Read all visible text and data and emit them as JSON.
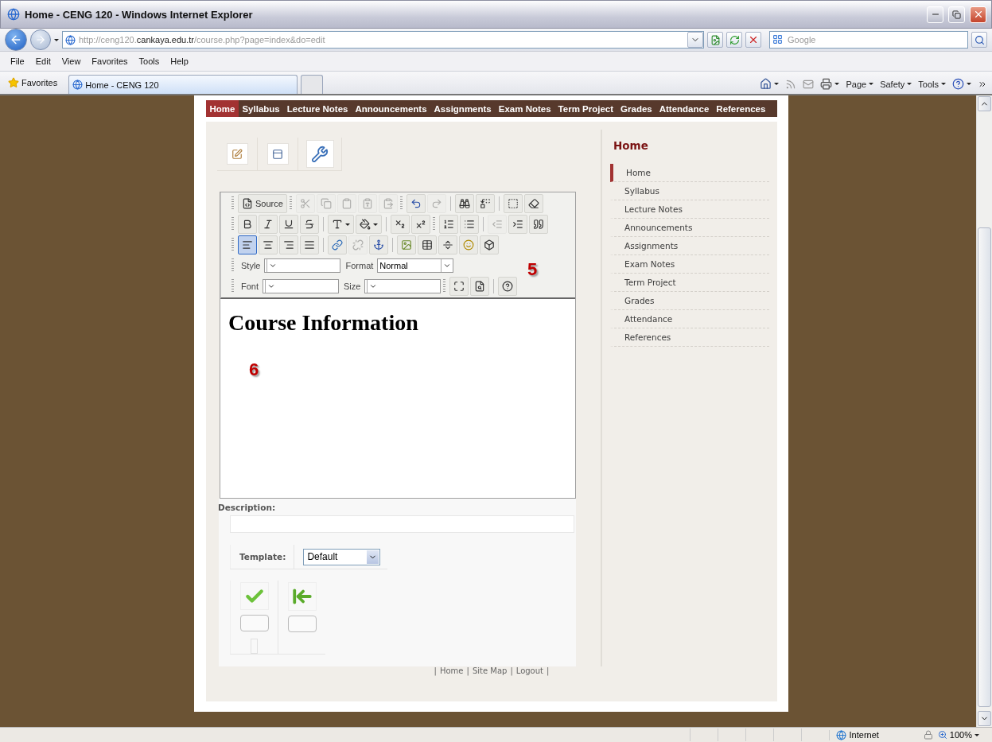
{
  "window": {
    "title": "Home - CENG 120 - Windows Internet Explorer"
  },
  "address_bar": {
    "url_prefix": "http://ceng120.",
    "url_host": "cankaya.edu.tr",
    "url_path": "/course.php?page=index&do=edit"
  },
  "search": {
    "placeholder": "Google"
  },
  "menu": [
    "File",
    "Edit",
    "View",
    "Favorites",
    "Tools",
    "Help"
  ],
  "favorites_bar": {
    "label": "Favorites",
    "tabs": [
      {
        "label": "Home - CENG 120",
        "selected": true
      }
    ]
  },
  "command_bar": [
    {
      "label": "Page"
    },
    {
      "label": "Safety"
    },
    {
      "label": "Tools"
    }
  ],
  "site_nav": [
    {
      "label": "Home",
      "selected": true
    },
    {
      "label": "Syllabus",
      "selected": false
    },
    {
      "label": "Lecture Notes",
      "selected": false
    },
    {
      "label": "Announcements",
      "selected": false
    },
    {
      "label": "Assignments",
      "selected": false
    },
    {
      "label": "Exam Notes",
      "selected": false
    },
    {
      "label": "Term Project",
      "selected": false
    },
    {
      "label": "Grades",
      "selected": false
    },
    {
      "label": "Attendance",
      "selected": false
    },
    {
      "label": "References",
      "selected": false
    }
  ],
  "editor": {
    "heading": "Course Information",
    "toolbar_rows": [
      [
        {
          "kind": "grip"
        },
        {
          "kind": "button",
          "label": "Source",
          "disabled": false,
          "selected": false
        },
        {
          "kind": "grip"
        },
        {
          "kind": "button",
          "disabled": true,
          "selected": false
        },
        {
          "kind": "button",
          "disabled": true,
          "selected": false
        },
        {
          "kind": "button",
          "disabled": true,
          "selected": false
        },
        {
          "kind": "button",
          "disabled": true,
          "selected": false
        },
        {
          "kind": "button",
          "disabled": true,
          "selected": false
        },
        {
          "kind": "grip"
        },
        {
          "kind": "button",
          "disabled": false,
          "selected": false
        },
        {
          "kind": "button",
          "disabled": true,
          "selected": false
        },
        {
          "kind": "separator"
        },
        {
          "kind": "button",
          "disabled": false,
          "selected": false
        },
        {
          "kind": "button",
          "disabled": false,
          "selected": false
        },
        {
          "kind": "separator"
        },
        {
          "kind": "button",
          "disabled": false,
          "selected": false
        },
        {
          "kind": "button",
          "disabled": false,
          "selected": false
        }
      ],
      [
        {
          "kind": "grip"
        },
        {
          "kind": "button",
          "disabled": false,
          "selected": false
        },
        {
          "kind": "button",
          "disabled": false,
          "selected": false
        },
        {
          "kind": "button",
          "disabled": false,
          "selected": false
        },
        {
          "kind": "button",
          "disabled": false,
          "selected": false
        },
        {
          "kind": "separator"
        },
        {
          "kind": "button",
          "disabled": false,
          "selected": false
        },
        {
          "kind": "button",
          "disabled": false,
          "selected": false
        },
        {
          "kind": "separator"
        },
        {
          "kind": "button",
          "disabled": false,
          "selected": false
        },
        {
          "kind": "button",
          "disabled": false,
          "selected": false
        },
        {
          "kind": "grip"
        },
        {
          "kind": "button",
          "disabled": false,
          "selected": false
        },
        {
          "kind": "button",
          "disabled": false,
          "selected": false
        },
        {
          "kind": "separator"
        },
        {
          "kind": "button",
          "disabled": true,
          "selected": false
        },
        {
          "kind": "button",
          "disabled": false,
          "selected": false
        },
        {
          "kind": "button",
          "disabled": false,
          "selected": false
        }
      ],
      [
        {
          "kind": "grip"
        },
        {
          "kind": "button",
          "disabled": false,
          "selected": true
        },
        {
          "kind": "button",
          "disabled": false,
          "selected": false
        },
        {
          "kind": "button",
          "disabled": false,
          "selected": false
        },
        {
          "kind": "button",
          "disabled": false,
          "selected": false
        },
        {
          "kind": "separator"
        },
        {
          "kind": "button",
          "disabled": false,
          "selected": false
        },
        {
          "kind": "button",
          "disabled": true,
          "selected": false
        },
        {
          "kind": "button",
          "disabled": false,
          "selected": false
        },
        {
          "kind": "separator"
        },
        {
          "kind": "button",
          "disabled": false,
          "selected": false
        },
        {
          "kind": "button",
          "disabled": false,
          "selected": false
        },
        {
          "kind": "button",
          "disabled": false,
          "selected": false
        },
        {
          "kind": "button",
          "disabled": false,
          "selected": false
        },
        {
          "kind": "button",
          "disabled": false,
          "selected": false
        }
      ],
      [
        {
          "kind": "grip"
        },
        {
          "kind": "combo",
          "label": "Style"
        },
        {
          "kind": "combo",
          "label": "Format",
          "value": "Normal"
        }
      ],
      [
        {
          "kind": "grip"
        },
        {
          "kind": "combo",
          "label": "Font"
        },
        {
          "kind": "combo",
          "label": "Size"
        },
        {
          "kind": "grip"
        },
        {
          "kind": "button",
          "disabled": false,
          "selected": false
        },
        {
          "kind": "button",
          "disabled": false,
          "selected": false
        },
        {
          "kind": "separator"
        },
        {
          "kind": "button",
          "disabled": false,
          "selected": false
        }
      ]
    ]
  },
  "annotations": [
    {
      "kind": "toolbar",
      "label": "5"
    },
    {
      "kind": "content",
      "label": "6"
    }
  ],
  "description": {
    "label": "Description:"
  },
  "template": {
    "label": "Template:",
    "value": "Default"
  },
  "sidebar": {
    "title": "Home",
    "items": [
      {
        "label": "Home",
        "selected": true
      },
      {
        "label": "Syllabus",
        "selected": false
      },
      {
        "label": "Lecture Notes",
        "selected": false
      },
      {
        "label": "Announcements",
        "selected": false
      },
      {
        "label": "Assignments",
        "selected": false
      },
      {
        "label": "Exam Notes",
        "selected": false
      },
      {
        "label": "Term Project",
        "selected": false
      },
      {
        "label": "Grades",
        "selected": false
      },
      {
        "label": "Attendance",
        "selected": false
      },
      {
        "label": "References",
        "selected": false
      }
    ]
  },
  "footer": {
    "separator": "|",
    "links": [
      "Home",
      "Site Map",
      "Logout"
    ]
  },
  "status_bar": {
    "zone": "Internet",
    "zoom": "100%"
  }
}
